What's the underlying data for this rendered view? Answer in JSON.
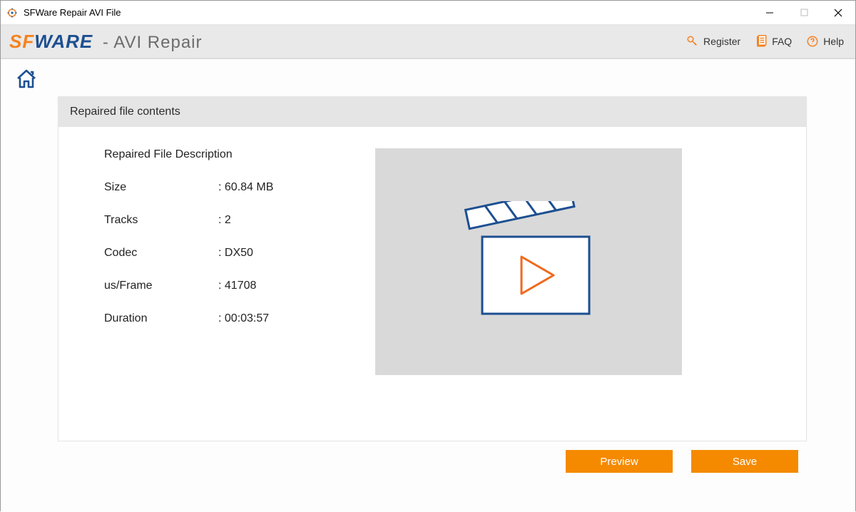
{
  "window": {
    "title": "SFWare Repair AVI File"
  },
  "logo": {
    "sf": "SF",
    "ware": "WARE",
    "suffix": " - AVI Repair"
  },
  "header_links": {
    "register": "Register",
    "faq": "FAQ",
    "help": "Help"
  },
  "panel": {
    "header": "Repaired file contents",
    "desc_title": "Repaired File Description",
    "rows": {
      "size": {
        "label": "Size",
        "value": "60.84 MB"
      },
      "tracks": {
        "label": "Tracks",
        "value": "2"
      },
      "codec": {
        "label": "Codec",
        "value": "DX50"
      },
      "usframe": {
        "label": "us/Frame",
        "value": "41708"
      },
      "duration": {
        "label": "Duration",
        "value": "00:03:57"
      }
    }
  },
  "buttons": {
    "preview": "Preview",
    "save": "Save"
  }
}
